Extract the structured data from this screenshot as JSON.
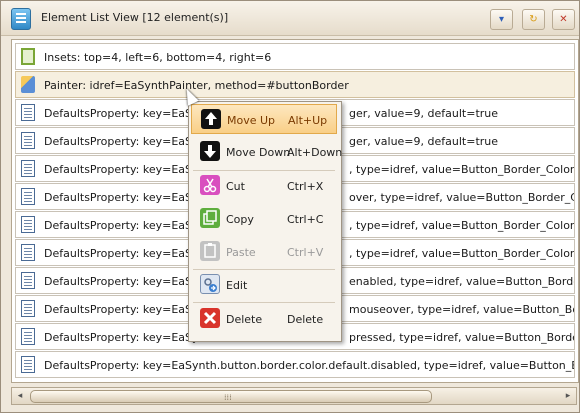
{
  "window": {
    "title": "Element List View [12 element(s)]"
  },
  "title_buttons": {
    "dropdown": "▾",
    "refresh": "↻",
    "close": "✕"
  },
  "rows": [
    {
      "icon": "inset-icon",
      "text": "Insets:  top=4, left=6, bottom=4, right=6"
    },
    {
      "icon": "painter-icon",
      "text": "Painter:  idref=EaSynthPainter, method=#buttonBorder"
    },
    {
      "icon": "document-icon",
      "text": "DefaultsProperty:  key=EaSyn"
    },
    {
      "icon": "document-icon",
      "text": "DefaultsProperty:  key=EaSyn"
    },
    {
      "icon": "document-icon",
      "text": "DefaultsProperty:  key=EaSyn"
    },
    {
      "icon": "document-icon",
      "text": "DefaultsProperty:  key=EaSyn"
    },
    {
      "icon": "document-icon",
      "text": "DefaultsProperty:  key=EaSyn"
    },
    {
      "icon": "document-icon",
      "text": "DefaultsProperty:  key=EaSyn"
    },
    {
      "icon": "document-icon",
      "text": "DefaultsProperty:  key=EaSyn"
    },
    {
      "icon": "document-icon",
      "text": "DefaultsProperty:  key=EaSyn"
    },
    {
      "icon": "document-icon",
      "text": "DefaultsProperty:  key=EaSyn"
    },
    {
      "icon": "document-icon",
      "text": "DefaultsProperty:  key=EaSynth.button.border.color.default.disabled, type=idref, value=Button_Border_Color_Default_Disabled"
    }
  ],
  "row_tails": [
    "",
    "",
    "ger, value=9, default=true",
    "ger, value=9, default=true",
    ", type=idref, value=Button_Border_Color_Enabled",
    "over, type=idref, value=Button_Border_Color_Mouseover",
    ", type=idref, value=Button_Border_Color_Pressed",
    ", type=idref, value=Button_Border_Color_Disabled",
    "enabled, type=idref, value=Button_Border_Color",
    "mouseover, type=idref, value=Button_Border_Color",
    "pressed, type=idref, value=Button_Border_Color",
    ""
  ],
  "context_menu": {
    "items": [
      {
        "icon": "arrow-up-icon",
        "label": "Move Up",
        "shortcut": "Alt+Up",
        "state": "highlighted"
      },
      {
        "icon": "arrow-down-icon",
        "label": "Move Down",
        "shortcut": "Alt+Down",
        "state": "normal"
      },
      {
        "icon": "cut-icon",
        "label": "Cut",
        "shortcut": "Ctrl+X",
        "state": "normal"
      },
      {
        "icon": "copy-icon",
        "label": "Copy",
        "shortcut": "Ctrl+C",
        "state": "normal"
      },
      {
        "icon": "paste-icon",
        "label": "Paste",
        "shortcut": "Ctrl+V",
        "state": "disabled"
      },
      {
        "icon": "edit-icon",
        "label": "Edit",
        "shortcut": "",
        "state": "normal"
      },
      {
        "icon": "delete-icon",
        "label": "Delete",
        "shortcut": "Delete",
        "state": "normal"
      }
    ]
  },
  "colors": {
    "highlight": "#f9cf87",
    "delete_red": "#d9342b",
    "accent_blue": "#2f88c6"
  }
}
